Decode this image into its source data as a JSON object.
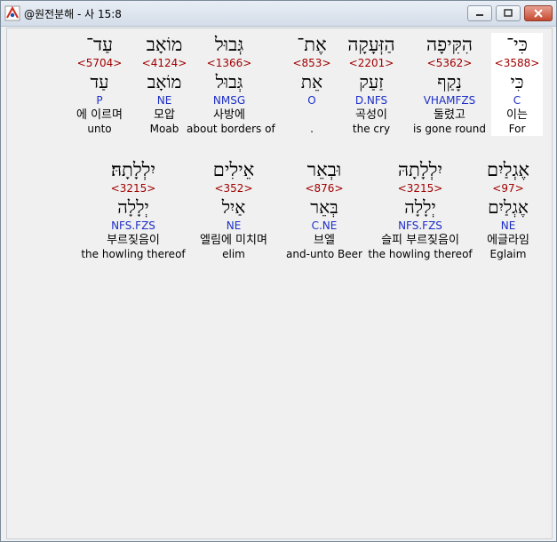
{
  "window": {
    "title": "@원전분해 - 사 15:8"
  },
  "row1": [
    {
      "heb": "כִּי־",
      "num": "<3588>",
      "lemma": "כִּי",
      "gram": "C",
      "kor": "이는",
      "eng": "For",
      "highlight": true
    },
    {
      "heb": "הִקִּיפָה",
      "num": "<5362>",
      "lemma": "נָקַף",
      "gram": "VHAMFZS",
      "kor": "둘렸고",
      "eng": "is gone round"
    },
    {
      "heb": "הַזְּעָקָה",
      "num": "<2201>",
      "lemma": "זַעַק",
      "gram": "D.NFS",
      "kor": "곡성이",
      "eng": "the cry"
    },
    {
      "heb": "אֶת־",
      "num": "<853>",
      "lemma": "אֵת",
      "gram": "O",
      "kor": "",
      "eng": "."
    },
    {
      "heb": "גְּבוּל",
      "num": "<1366>",
      "lemma": "גְּבוּל",
      "gram": "NMSG",
      "kor": "사방에",
      "eng": "about borders of"
    },
    {
      "heb": "מוֹאָב",
      "num": "<4124>",
      "lemma": "מוֹאָב",
      "gram": "NE",
      "kor": "모압",
      "eng": "Moab"
    },
    {
      "heb": "עַד־",
      "num": "<5704>",
      "lemma": "עַד",
      "gram": "P",
      "kor": "에 이르며",
      "eng": "unto"
    }
  ],
  "row2": [
    {
      "heb": "אֶגְלַיִם",
      "num": "<97>",
      "lemma": "אֶגְלַיִם",
      "gram": "NE",
      "kor": "에글라임",
      "eng": "Eglaim"
    },
    {
      "heb": "יִלְלָתָהּ",
      "num": "<3215>",
      "lemma": "יְלָלָה",
      "gram": "NFS.FZS",
      "kor": "슬피 부르짖음이",
      "eng": "the howling thereof"
    },
    {
      "heb": "וּבְאֵר",
      "num": "<876>",
      "lemma": "בְּאֵר",
      "gram": "C.NE",
      "kor": "브엘",
      "eng": "and-unto Beer"
    },
    {
      "heb": "אֵילִים",
      "num": "<352>",
      "lemma": "אַיִל",
      "gram": "NE",
      "kor": "엘림에 미치며",
      "eng": "elim"
    },
    {
      "heb": "יִלְלָתָהּ׃",
      "num": "<3215>",
      "lemma": "יְלָלָה",
      "gram": "NFS.FZS",
      "kor": "부르짖음이",
      "eng": "the howling thereof"
    }
  ]
}
